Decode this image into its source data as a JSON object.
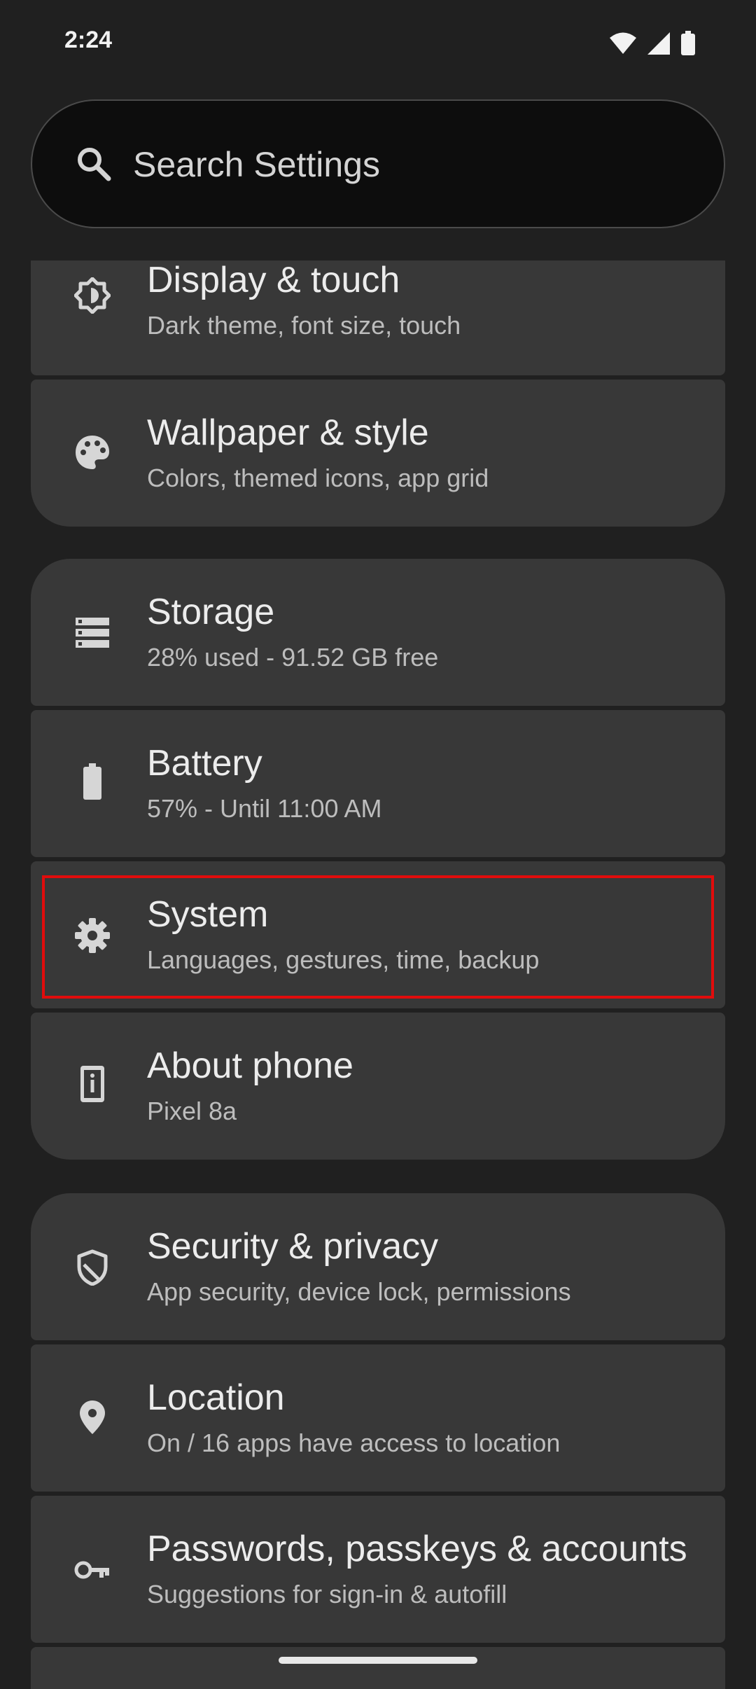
{
  "status": {
    "time": "2:24"
  },
  "search": {
    "placeholder": "Search Settings"
  },
  "items": [
    {
      "title": "Display & touch",
      "subtitle": "Dark theme, font size, touch",
      "icon": "display-icon"
    },
    {
      "title": "Wallpaper & style",
      "subtitle": "Colors, themed icons, app grid",
      "icon": "palette-icon"
    },
    {
      "title": "Storage",
      "subtitle": "28% used - 91.52 GB free",
      "icon": "storage-icon"
    },
    {
      "title": "Battery",
      "subtitle": "57% - Until 11:00 AM",
      "icon": "battery-icon"
    },
    {
      "title": "System",
      "subtitle": "Languages, gestures, time, backup",
      "icon": "gear-icon"
    },
    {
      "title": "About phone",
      "subtitle": "Pixel 8a",
      "icon": "phone-info-icon"
    },
    {
      "title": "Security & privacy",
      "subtitle": "App security, device lock, permissions",
      "icon": "shield-icon"
    },
    {
      "title": "Location",
      "subtitle": "On / 16 apps have access to location",
      "icon": "location-pin-icon"
    },
    {
      "title": "Passwords, passkeys & accounts",
      "subtitle": "Suggestions for sign-in & autofill",
      "icon": "key-icon"
    }
  ],
  "colors": {
    "background": "#202020",
    "card": "#383838",
    "highlight": "#e10c0c"
  }
}
